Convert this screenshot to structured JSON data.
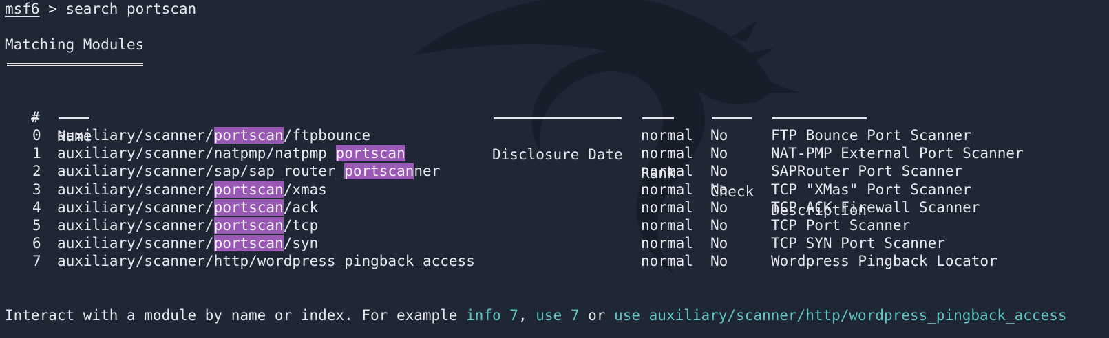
{
  "prompt": {
    "name": "msf6",
    "separator": " > ",
    "command": "search portscan"
  },
  "section_title": "Matching Modules",
  "table": {
    "headers": {
      "index": "#",
      "name": "Name",
      "date": "Disclosure Date",
      "rank": "Rank",
      "check": "Check",
      "description": "Description"
    },
    "rows": [
      {
        "index": "0",
        "name_pre": "auxiliary/scanner/",
        "name_hl": "portscan",
        "name_post": "/ftpbounce",
        "date": "",
        "rank": "normal",
        "check": "No",
        "description": "FTP Bounce Port Scanner"
      },
      {
        "index": "1",
        "name_pre": "auxiliary/scanner/natpmp/natpmp_",
        "name_hl": "portscan",
        "name_post": "",
        "date": "",
        "rank": "normal",
        "check": "No",
        "description": "NAT-PMP External Port Scanner"
      },
      {
        "index": "2",
        "name_pre": "auxiliary/scanner/sap/sap_router_",
        "name_hl": "portscan",
        "name_post": "ner",
        "date": "",
        "rank": "normal",
        "check": "No",
        "description": "SAPRouter Port Scanner"
      },
      {
        "index": "3",
        "name_pre": "auxiliary/scanner/",
        "name_hl": "portscan",
        "name_post": "/xmas",
        "date": "",
        "rank": "normal",
        "check": "No",
        "description": "TCP \"XMas\" Port Scanner"
      },
      {
        "index": "4",
        "name_pre": "auxiliary/scanner/",
        "name_hl": "portscan",
        "name_post": "/ack",
        "date": "",
        "rank": "normal",
        "check": "No",
        "description": "TCP ACK Firewall Scanner"
      },
      {
        "index": "5",
        "name_pre": "auxiliary/scanner/",
        "name_hl": "portscan",
        "name_post": "/tcp",
        "date": "",
        "rank": "normal",
        "check": "No",
        "description": "TCP Port Scanner"
      },
      {
        "index": "6",
        "name_pre": "auxiliary/scanner/",
        "name_hl": "portscan",
        "name_post": "/syn",
        "date": "",
        "rank": "normal",
        "check": "No",
        "description": "TCP SYN Port Scanner"
      },
      {
        "index": "7",
        "name_pre": "auxiliary/scanner/http/wordpress_pingback_access",
        "name_hl": "",
        "name_post": "",
        "date": "",
        "rank": "normal",
        "check": "No",
        "description": "Wordpress Pingback Locator"
      }
    ]
  },
  "footer": {
    "text1": "Interact with a module by name or index. For example ",
    "link1": "info 7",
    "text2": ", ",
    "link2": "use 7",
    "text3": " or ",
    "link3": "use auxiliary/scanner/http/wordpress_pingback_access"
  },
  "colors": {
    "background": "#1f2634",
    "foreground": "#e6e8ee",
    "highlight": "#9b59b6",
    "link": "#5fc7c1"
  },
  "background_icon": "kali-dragon-watermark"
}
